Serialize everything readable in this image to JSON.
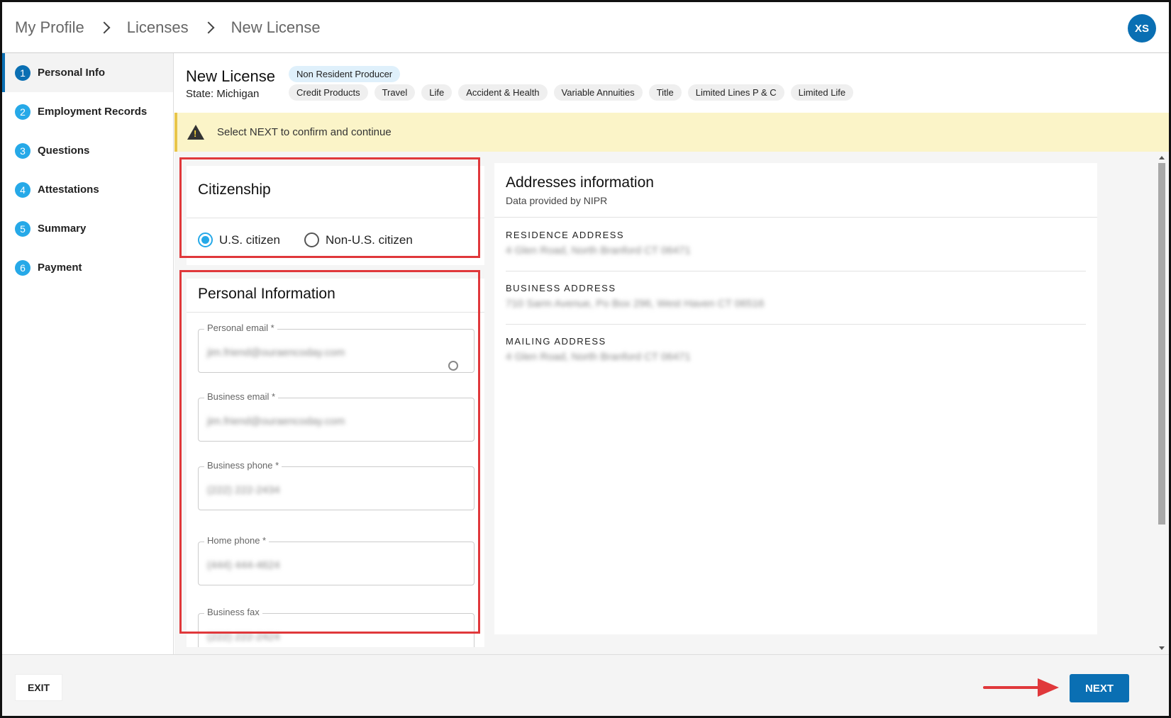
{
  "breadcrumb": {
    "items": [
      "My Profile",
      "Licenses",
      "New License"
    ]
  },
  "user": {
    "initials": "XS"
  },
  "steps": [
    {
      "num": "1",
      "label": "Personal Info"
    },
    {
      "num": "2",
      "label": "Employment Records"
    },
    {
      "num": "3",
      "label": "Questions"
    },
    {
      "num": "4",
      "label": "Attestations"
    },
    {
      "num": "5",
      "label": "Summary"
    },
    {
      "num": "6",
      "label": "Payment"
    }
  ],
  "license": {
    "title": "New License",
    "state": "State: Michigan",
    "type_tag": "Non Resident Producer",
    "lines": [
      "Credit Products",
      "Travel",
      "Life",
      "Accident & Health",
      "Variable Annuities",
      "Title",
      "Limited Lines P & C",
      "Limited Life"
    ]
  },
  "alert": {
    "text": "Select NEXT to confirm and continue"
  },
  "citizenship": {
    "title": "Citizenship",
    "options": [
      "U.S. citizen",
      "Non-U.S. citizen"
    ],
    "selected": "U.S. citizen"
  },
  "personal_info": {
    "title": "Personal Information",
    "fields": [
      {
        "label": "Personal email *",
        "value": "jim.friend@ouraencoday.com"
      },
      {
        "label": "Business email *",
        "value": "jim.friend@ouraencoday.com"
      },
      {
        "label": "Business phone *",
        "value": "(222) 222-2434"
      },
      {
        "label": "Home phone *",
        "value": "(444) 444-4624"
      },
      {
        "label": "Business fax",
        "value": "(222) 222-2424"
      }
    ]
  },
  "addresses": {
    "title": "Addresses information",
    "subtitle": "Data provided by NIPR",
    "items": [
      {
        "label": "RESIDENCE ADDRESS",
        "value": "4 Glen Road, North Branford CT 06471"
      },
      {
        "label": "BUSINESS ADDRESS",
        "value": "710 Sarm Avenue, Po Box 296, West Haven CT 06516"
      },
      {
        "label": "MAILING ADDRESS",
        "value": "4 Glen Road, North Branford CT 06471"
      }
    ]
  },
  "footer": {
    "exit_label": "EXIT",
    "next_label": "NEXT"
  },
  "colors": {
    "primary": "#0a6fb3",
    "step_accent": "#26a9e8",
    "alert_bg": "#fbf4c8",
    "highlight": "#e0383b"
  }
}
